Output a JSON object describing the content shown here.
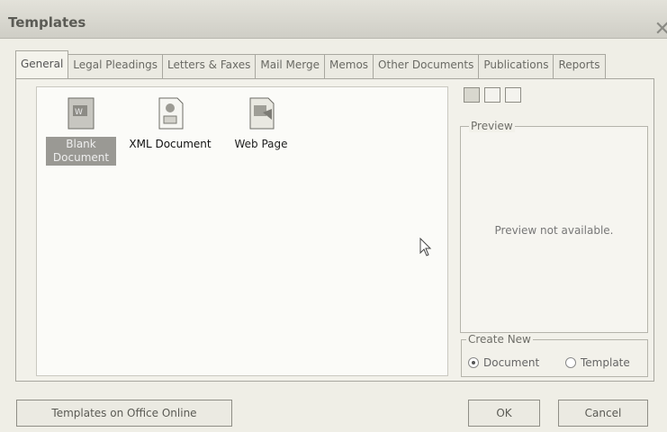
{
  "dialog": {
    "title": "Templates"
  },
  "tabs": [
    {
      "label": "General"
    },
    {
      "label": "Legal Pleadings"
    },
    {
      "label": "Letters & Faxes"
    },
    {
      "label": "Mail Merge"
    },
    {
      "label": "Memos"
    },
    {
      "label": "Other Documents"
    },
    {
      "label": "Publications"
    },
    {
      "label": "Reports"
    }
  ],
  "items": [
    {
      "label": "Blank Document",
      "icon": "word-document-icon"
    },
    {
      "label": "XML Document",
      "icon": "xml-document-icon"
    },
    {
      "label": "Web Page",
      "icon": "web-page-icon"
    }
  ],
  "preview": {
    "legend": "Preview",
    "message": "Preview not available."
  },
  "create_new": {
    "legend": "Create New",
    "document": "Document",
    "template": "Template",
    "selected": "Document"
  },
  "buttons": {
    "online": "Templates on Office Online",
    "ok": "OK",
    "cancel": "Cancel"
  }
}
